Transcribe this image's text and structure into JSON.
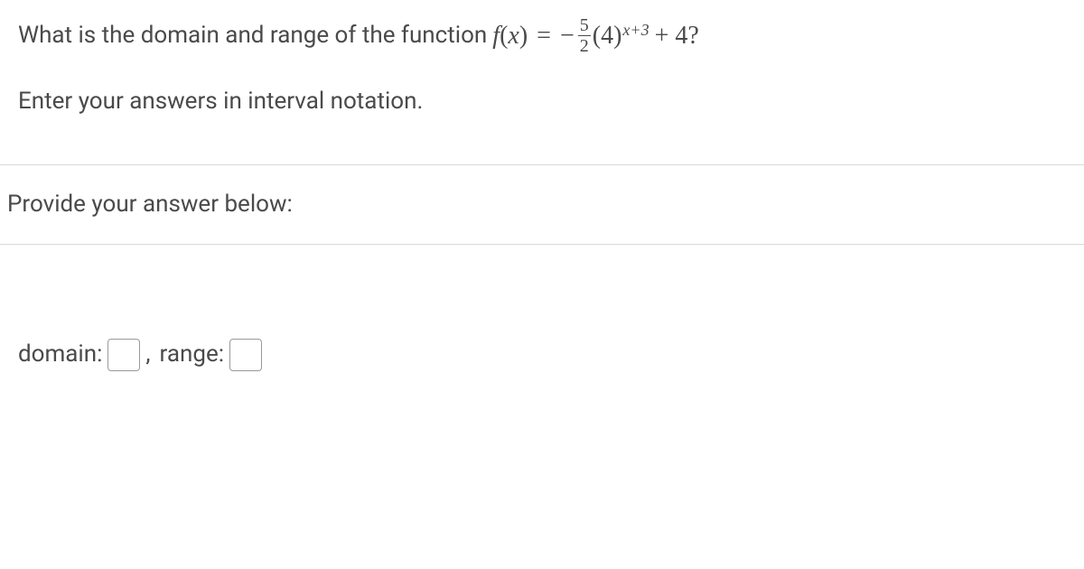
{
  "question": {
    "text_before_math": "What is the domain and range of the function",
    "math": {
      "fx": "f",
      "var": "x",
      "frac_num": "5",
      "frac_den": "2",
      "base": "4",
      "exp_var": "x",
      "exp_plus": "+3",
      "tail": " + 4?"
    },
    "instruction": "Enter your answers in interval notation."
  },
  "prompt": "Provide your answer below:",
  "answer": {
    "domain_label": "domain:",
    "comma": ",",
    "range_label": "range:"
  }
}
